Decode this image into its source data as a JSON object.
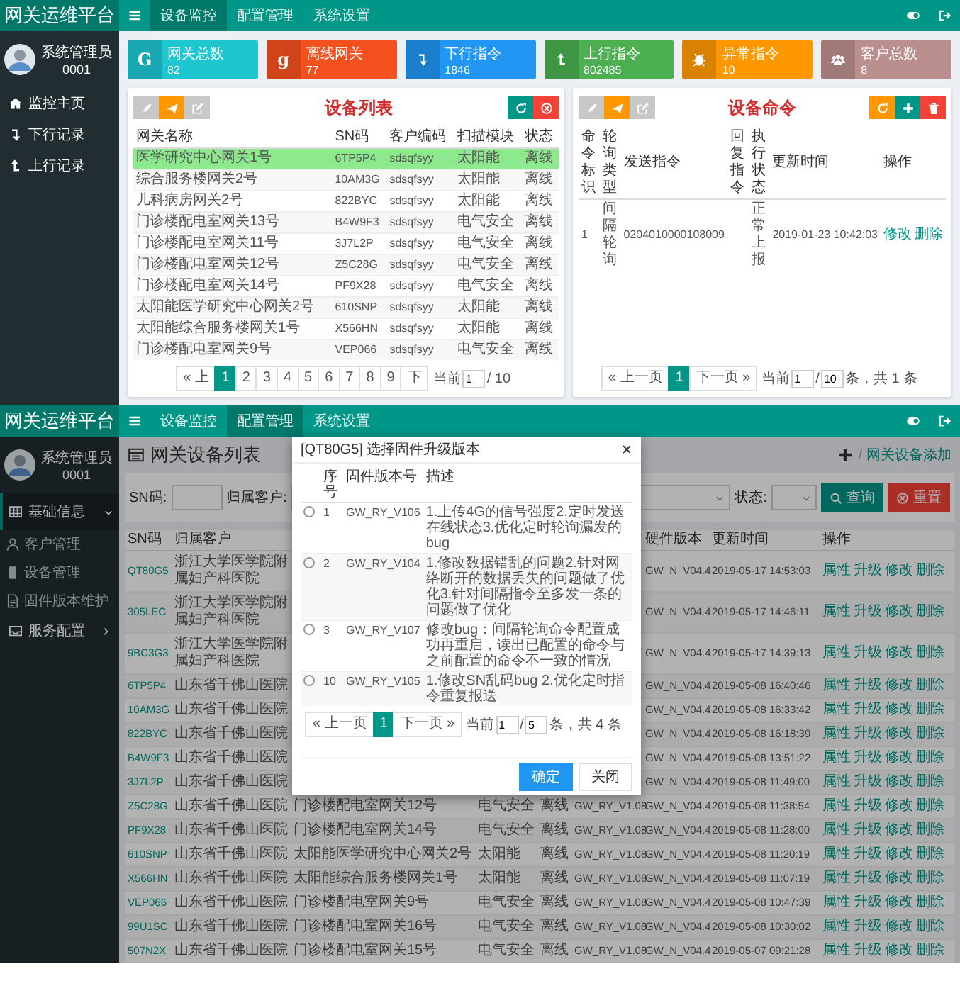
{
  "top": {
    "header": {
      "brand": "网关运维平台",
      "nav": [
        {
          "label": "设备监控",
          "selected": true
        },
        {
          "label": "配置管理",
          "selected": false
        },
        {
          "label": "系统设置",
          "selected": false
        }
      ]
    },
    "user": {
      "name": "系统管理员",
      "id": "0001"
    },
    "sidebar": {
      "items": [
        {
          "label": "监控主页"
        },
        {
          "label": "下行记录"
        },
        {
          "label": "上行记录"
        }
      ]
    },
    "stats": [
      {
        "label": "网关总数",
        "value": "82",
        "color": "#1ec6d0",
        "glyph": "G"
      },
      {
        "label": "离线网关",
        "value": "77",
        "color": "#f4511e",
        "glyph": "g"
      },
      {
        "label": "下行指令",
        "value": "1846",
        "color": "#2196f3"
      },
      {
        "label": "上行指令",
        "value": "802485",
        "color": "#4caf50"
      },
      {
        "label": "异常指令",
        "value": "10",
        "color": "#ff9800"
      },
      {
        "label": "客户总数",
        "value": "8",
        "color": "#bc8f8f"
      }
    ],
    "device_list": {
      "title": "设备列表",
      "columns": [
        "网关名称",
        "SN码",
        "客户编码",
        "扫描模块",
        "状态"
      ],
      "rows": [
        {
          "cells": [
            "医学研究中心网关1号",
            "6TP5P4",
            "sdsqfsyy",
            "太阳能",
            "离线"
          ],
          "selected": true
        },
        {
          "cells": [
            "综合服务楼网关2号",
            "10AM3G",
            "sdsqfsyy",
            "太阳能",
            "离线"
          ],
          "selected": false
        },
        {
          "cells": [
            "儿科病房网关2号",
            "822BYC",
            "sdsqfsyy",
            "太阳能",
            "离线"
          ],
          "selected": false
        },
        {
          "cells": [
            "门诊楼配电室网关13号",
            "B4W9F3",
            "sdsqfsyy",
            "电气安全",
            "离线"
          ],
          "selected": false
        },
        {
          "cells": [
            "门诊楼配电室网关11号",
            "3J7L2P",
            "sdsqfsyy",
            "电气安全",
            "离线"
          ],
          "selected": false
        },
        {
          "cells": [
            "门诊楼配电室网关12号",
            "Z5C28G",
            "sdsqfsyy",
            "电气安全",
            "离线"
          ],
          "selected": false
        },
        {
          "cells": [
            "门诊楼配电室网关14号",
            "PF9X28",
            "sdsqfsyy",
            "电气安全",
            "离线"
          ],
          "selected": false
        },
        {
          "cells": [
            "太阳能医学研究中心网关2号",
            "610SNP",
            "sdsqfsyy",
            "太阳能",
            "离线"
          ],
          "selected": false
        },
        {
          "cells": [
            "太阳能综合服务楼网关1号",
            "X566HN",
            "sdsqfsyy",
            "太阳能",
            "离线"
          ],
          "selected": false
        },
        {
          "cells": [
            "门诊楼配电室网关9号",
            "VEP066",
            "sdsqfsyy",
            "电气安全",
            "离线"
          ],
          "selected": false
        }
      ],
      "pagination": {
        "prev": "« 上",
        "pages": [
          {
            "label": "1",
            "selected": true
          },
          {
            "label": "2",
            "selected": false
          },
          {
            "label": "3",
            "selected": false
          },
          {
            "label": "4",
            "selected": false
          },
          {
            "label": "5",
            "selected": false
          },
          {
            "label": "6",
            "selected": false
          },
          {
            "label": "7",
            "selected": false
          },
          {
            "label": "8",
            "selected": false
          },
          {
            "label": "9",
            "selected": false
          }
        ],
        "next": "下",
        "current_label": "当前",
        "current": "1",
        "total": "/ 10"
      }
    },
    "device_commands": {
      "title": "设备命令",
      "columns": [
        "命令标识",
        "轮询类型",
        "发送指令",
        "回复指令",
        "执行状态",
        "更新时间",
        "操作"
      ],
      "rows": [
        {
          "id": "1",
          "type": "间隔轮询",
          "sent": "0204010000108009",
          "status": "正常上报",
          "time": "2019-01-23 10:42:03",
          "actions": [
            "修改",
            "删除"
          ]
        }
      ],
      "pagination": {
        "prev": "« 上一页",
        "pages": [
          {
            "label": "1",
            "selected": true
          }
        ],
        "next": "下一页 »",
        "current_label": "当前",
        "current": "1",
        "sep": "/",
        "total": "10",
        "summary": "条，共 1 条"
      }
    }
  },
  "bottom": {
    "header": {
      "brand": "网关运维平台",
      "nav": [
        {
          "label": "设备监控",
          "selected": false
        },
        {
          "label": "配置管理",
          "selected": true
        },
        {
          "label": "系统设置",
          "selected": false
        }
      ]
    },
    "user": {
      "name": "系统管理员",
      "id": "0001"
    },
    "sidebar": {
      "items": [
        {
          "label": "基础信息",
          "expanded": true,
          "children": [
            {
              "label": "客户管理"
            },
            {
              "label": "设备管理"
            },
            {
              "label": "固件版本维护"
            }
          ]
        },
        {
          "label": "服务配置",
          "expanded": false
        }
      ]
    },
    "page_title": "网关设备列表",
    "breadcrumb": {
      "separator": "/",
      "link": "网关设备添加"
    },
    "filter": {
      "sn_label": "SN码:",
      "customer_label": "归属客户:",
      "status_label": "状态:",
      "buttons": [
        {
          "label": "查询",
          "kind": "search"
        },
        {
          "label": "重置",
          "kind": "reset"
        }
      ]
    },
    "table": {
      "columns": {
        "sn": "SN码",
        "customer": "归属客户",
        "hardware": "硬件版本",
        "time": "更新时间",
        "actions": "操作"
      },
      "rows": [
        {
          "sn": "QT80G5",
          "customer": "浙江大学医学院附属妇产科医院",
          "hardware": "GW_N_V04.4",
          "time": "2019-05-17 14:53:03",
          "actions": [
            "属性",
            "升级",
            "修改",
            "删除"
          ]
        },
        {
          "sn": "305LEC",
          "customer": "浙江大学医学院附属妇产科医院",
          "hardware": "GW_N_V04.4",
          "time": "2019-05-17 14:46:11",
          "actions": [
            "属性",
            "升级",
            "修改",
            "删除"
          ]
        },
        {
          "sn": "9BC3G3",
          "customer": "浙江大学医学院附属妇产科医院",
          "hardware": "GW_N_V04.4",
          "time": "2019-05-17 14:39:13",
          "actions": [
            "属性",
            "升级",
            "修改",
            "删除"
          ]
        },
        {
          "sn": "6TP5P4",
          "customer": "山东省千佛山医院",
          "hardware": "GW_N_V04.4",
          "time": "2019-05-08 16:40:46",
          "actions": [
            "属性",
            "升级",
            "修改",
            "删除"
          ]
        },
        {
          "sn": "10AM3G",
          "customer": "山东省千佛山医院",
          "hardware": "GW_N_V04.4",
          "time": "2019-05-08 16:33:42",
          "actions": [
            "属性",
            "升级",
            "修改",
            "删除"
          ]
        },
        {
          "sn": "822BYC",
          "customer": "山东省千佛山医院",
          "hardware": "GW_N_V04.4",
          "time": "2019-05-08 16:18:39",
          "actions": [
            "属性",
            "升级",
            "修改",
            "删除"
          ]
        },
        {
          "sn": "B4W9F3",
          "customer": "山东省千佛山医院",
          "hardware": "GW_N_V04.4",
          "time": "2019-05-08 13:51:22",
          "actions": [
            "属性",
            "升级",
            "修改",
            "删除"
          ]
        },
        {
          "sn": "3J7L2P",
          "customer": "山东省千佛山医院",
          "hardware": "GW_N_V04.4",
          "time": "2019-05-08 11:49:00",
          "actions": [
            "属性",
            "升级",
            "修改",
            "删除"
          ]
        },
        {
          "sn": "Z5C28G",
          "customer": "山东省千佛山医院",
          "name": "门诊楼配电室网关12号",
          "type": "电气安全",
          "status": "离线",
          "firmware": "GW_RY_V1.08",
          "hardware": "GW_N_V04.4",
          "time": "2019-05-08 11:38:54",
          "actions": [
            "属性",
            "升级",
            "修改",
            "删除"
          ]
        },
        {
          "sn": "PF9X28",
          "customer": "山东省千佛山医院",
          "name": "门诊楼配电室网关14号",
          "type": "电气安全",
          "status": "离线",
          "firmware": "GW_RY_V1.08",
          "hardware": "GW_N_V04.4",
          "time": "2019-05-08 11:28:00",
          "actions": [
            "属性",
            "升级",
            "修改",
            "删除"
          ]
        },
        {
          "sn": "610SNP",
          "customer": "山东省千佛山医院",
          "name": "太阳能医学研究中心网关2号",
          "type": "太阳能",
          "status": "离线",
          "firmware": "GW_RY_V1.08",
          "hardware": "GW_N_V04.4",
          "time": "2019-05-08 11:20:19",
          "actions": [
            "属性",
            "升级",
            "修改",
            "删除"
          ]
        },
        {
          "sn": "X566HN",
          "customer": "山东省千佛山医院",
          "name": "太阳能综合服务楼网关1号",
          "type": "太阳能",
          "status": "离线",
          "firmware": "GW_RY_V1.08",
          "hardware": "GW_N_V04.4",
          "time": "2019-05-08 11:07:19",
          "actions": [
            "属性",
            "升级",
            "修改",
            "删除"
          ]
        },
        {
          "sn": "VEP066",
          "customer": "山东省千佛山医院",
          "name": "门诊楼配电室网关9号",
          "type": "电气安全",
          "status": "离线",
          "firmware": "GW_RY_V1.08",
          "hardware": "GW_N_V04.4",
          "time": "2019-05-08 10:47:39",
          "actions": [
            "属性",
            "升级",
            "修改",
            "删除"
          ]
        },
        {
          "sn": "99U1SC",
          "customer": "山东省千佛山医院",
          "name": "门诊楼配电室网关16号",
          "type": "电气安全",
          "status": "离线",
          "firmware": "GW_RY_V1.08",
          "hardware": "GW_N_V04.4",
          "time": "2019-05-08 10:30:02",
          "actions": [
            "属性",
            "升级",
            "修改",
            "删除"
          ]
        },
        {
          "sn": "507N2X",
          "customer": "山东省千佛山医院",
          "name": "门诊楼配电室网关15号",
          "type": "电气安全",
          "status": "离线",
          "firmware": "GW_RY_V1.08",
          "hardware": "GW_N_V04.4",
          "time": "2019-05-07 09:21:28",
          "actions": [
            "属性",
            "升级",
            "修改",
            "删除"
          ]
        }
      ]
    },
    "dialog": {
      "title": "[QT80G5] 选择固件升级版本",
      "columns": [
        "序号",
        "固件版本号",
        "描述"
      ],
      "rows": [
        {
          "no": "1",
          "version": "GW_RY_V106",
          "desc": "1.上传4G的信号强度2.定时发送在线状态3.优化定时轮询漏发的bug",
          "selected": false
        },
        {
          "no": "2",
          "version": "GW_RY_V104",
          "desc": "1.修改数据错乱的问题2.针对网络断开的数据丢失的问题做了优化3.针对间隔指令至多发一条的问题做了优化",
          "selected": false
        },
        {
          "no": "3",
          "version": "GW_RY_V107",
          "desc": "修改bug：间隔轮询命令配置成功再重启，读出已配置的命令与之前配置的命令不一致的情况",
          "selected": false
        },
        {
          "no": "10",
          "version": "GW_RY_V105",
          "desc": "1.修改SN乱码bug 2.优化定时指令重复报送",
          "selected": false
        }
      ],
      "pagination": {
        "prev": "« 上一页",
        "pages": [
          {
            "label": "1",
            "selected": true
          }
        ],
        "next": "下一页 »",
        "current_label": "当前",
        "current": "1",
        "sep": "/",
        "total": "5",
        "summary": "条，共 4 条"
      },
      "buttons": [
        {
          "label": "确定",
          "kind": "primary"
        },
        {
          "label": "关闭",
          "kind": "default"
        }
      ]
    }
  }
}
